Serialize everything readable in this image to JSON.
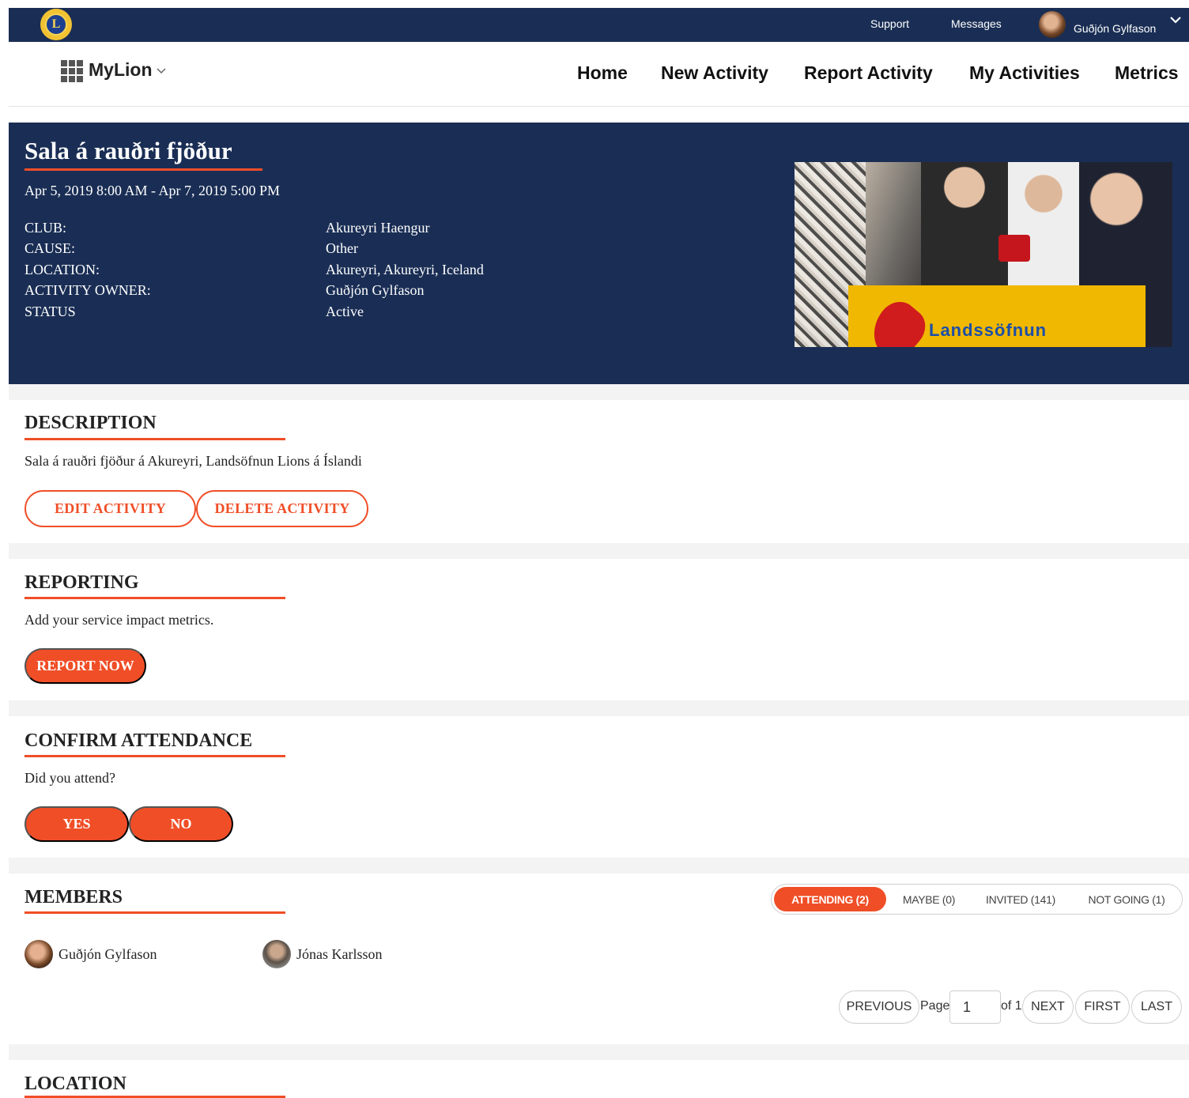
{
  "topbar": {
    "logo_letter": "L",
    "support": "Support",
    "messages": "Messages",
    "user_name": "Guðjón Gylfason"
  },
  "nav": {
    "brand": "MyLion",
    "links": [
      "Home",
      "New Activity",
      "Report Activity",
      "My Activities",
      "Metrics"
    ]
  },
  "activity": {
    "title": "Sala á rauðri fjöður",
    "date_range": "Apr 5, 2019 8:00 AM - Apr 7, 2019 5:00 PM",
    "details": [
      {
        "label": "CLUB:",
        "value": "Akureyri Haengur"
      },
      {
        "label": "CAUSE:",
        "value": "Other"
      },
      {
        "label": "LOCATION:",
        "value": "Akureyri, Akureyri, Iceland"
      },
      {
        "label": "ACTIVITY OWNER:",
        "value": "Guðjón Gylfason"
      },
      {
        "label": "STATUS",
        "value": "Active"
      }
    ],
    "image_banner_text": "Landssöfnun"
  },
  "description": {
    "title": "DESCRIPTION",
    "text": "Sala á rauðri fjöður á Akureyri, Landsöfnun Lions á Íslandi",
    "edit_label": "EDIT ACTIVITY",
    "delete_label": "DELETE ACTIVITY"
  },
  "reporting": {
    "title": "REPORTING",
    "text": "Add your service impact metrics.",
    "report_label": "REPORT NOW"
  },
  "attendance": {
    "title": "CONFIRM ATTENDANCE",
    "text": "Did you attend?",
    "yes_label": "YES",
    "no_label": "NO"
  },
  "members": {
    "title": "MEMBERS",
    "tabs": [
      "ATTENDING (2)",
      "MAYBE (0)",
      "INVITED (141)",
      "NOT GOING (1)"
    ],
    "list": [
      "Guðjón Gylfason",
      "Jónas Karlsson"
    ]
  },
  "pagination": {
    "previous": "PREVIOUS",
    "page_label": "Page",
    "page_value": "1",
    "of_label": "of 1",
    "next": "NEXT",
    "first": "FIRST",
    "last": "LAST"
  },
  "location": {
    "title": "LOCATION"
  },
  "colors": {
    "navy": "#1a2e55",
    "accent": "#f04e27"
  }
}
